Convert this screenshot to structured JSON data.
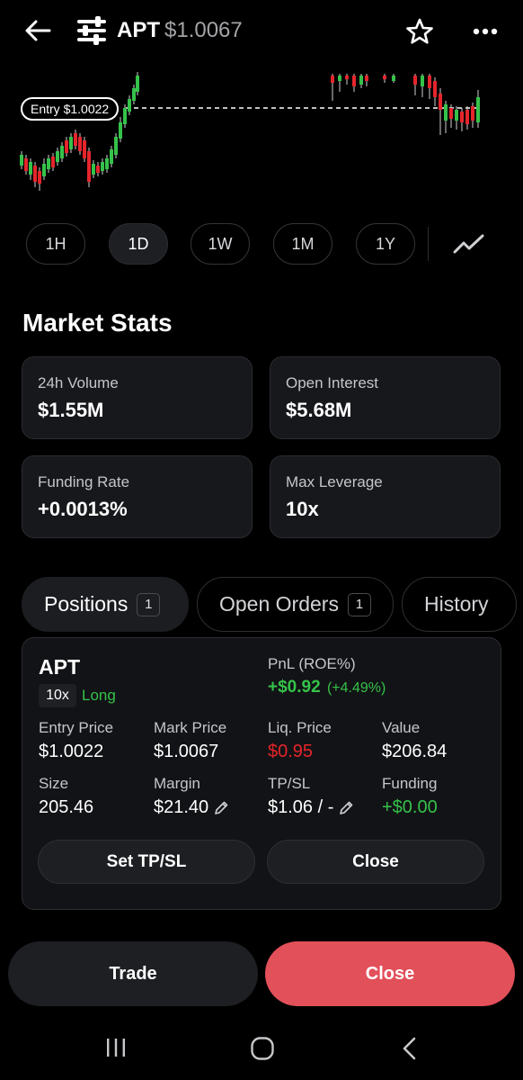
{
  "header": {
    "symbol": "APT",
    "price": "$1.0067",
    "icons": [
      "back-arrow-icon",
      "sliders-logo-icon",
      "star-icon",
      "more-icon"
    ]
  },
  "chart": {
    "entry_label": "Entry $1.0022",
    "up_color": "#35c24a",
    "down_color": "#e5252b"
  },
  "timeframes": [
    {
      "label": "1H",
      "active": false
    },
    {
      "label": "1D",
      "active": true
    },
    {
      "label": "1W",
      "active": false
    },
    {
      "label": "1M",
      "active": false
    },
    {
      "label": "1Y",
      "active": false
    }
  ],
  "market_stats": {
    "title": "Market Stats",
    "items": [
      {
        "label": "24h Volume",
        "value": "$1.55M"
      },
      {
        "label": "Open Interest",
        "value": "$5.68M"
      },
      {
        "label": "Funding Rate",
        "value": "+0.0013%"
      },
      {
        "label": "Max Leverage",
        "value": "10x"
      }
    ]
  },
  "tabs": [
    {
      "label": "Positions",
      "count": "1",
      "active": true
    },
    {
      "label": "Open Orders",
      "count": "1",
      "active": false
    },
    {
      "label": "History",
      "active": false
    }
  ],
  "position": {
    "symbol": "APT",
    "leverage": "10x",
    "side": "Long",
    "pnl_label": "PnL (ROE%)",
    "pnl_value": "+$0.92",
    "pnl_pct": "(+4.49%)",
    "fields": {
      "entry_price": {
        "label": "Entry Price",
        "value": "$1.0022"
      },
      "mark_price": {
        "label": "Mark Price",
        "value": "$1.0067"
      },
      "liq_price": {
        "label": "Liq. Price",
        "value": "$0.95"
      },
      "value": {
        "label": "Value",
        "value": "$206.84"
      },
      "size": {
        "label": "Size",
        "value": "205.46"
      },
      "margin": {
        "label": "Margin",
        "value": "$21.40"
      },
      "tpsl": {
        "label": "TP/SL",
        "value": "$1.06 / -"
      },
      "funding": {
        "label": "Funding",
        "value": "+$0.00"
      }
    },
    "set_tpsl_label": "Set TP/SL",
    "close_label": "Close"
  },
  "actions": {
    "trade_label": "Trade",
    "close_label": "Close",
    "close_color": "#e2505a"
  }
}
